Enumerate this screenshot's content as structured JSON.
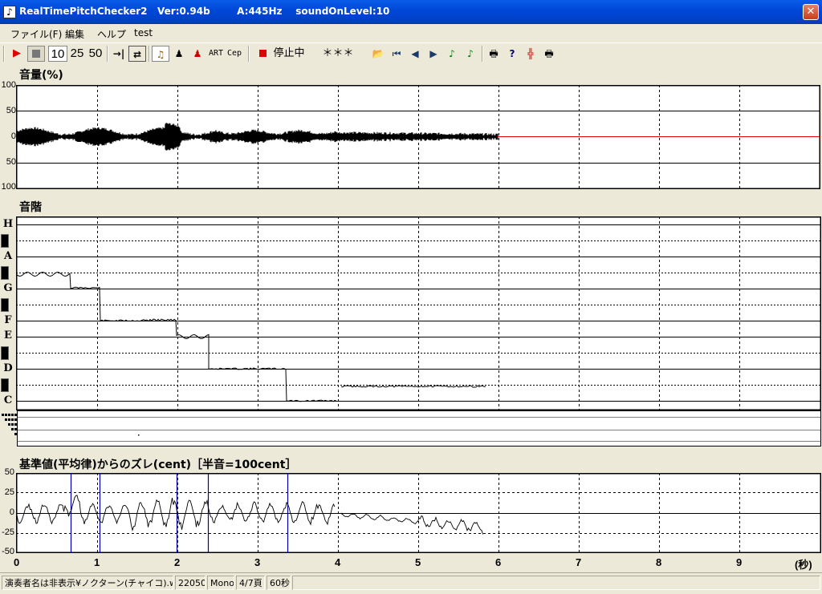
{
  "window": {
    "title": "RealTimePitchChecker2   Ver:0.94b        A:445Hz    soundOnLevel:10",
    "close_icon": "close-icon"
  },
  "menu": [
    "ファイル(F)",
    "編集",
    "ヘルプ",
    "test"
  ],
  "toolbar": {
    "speed_10": "10",
    "speed_25": "25",
    "speed_50": "50",
    "art_label": "ART",
    "cep_label": "Cep",
    "status_label": "停止中",
    "note_display": "＊＊＊",
    "colors": {
      "record": "#e00000",
      "green_note": "#008000"
    }
  },
  "volume_panel": {
    "label": "音量(%)",
    "y_ticks": [
      "100",
      "50",
      "0",
      "50",
      "100"
    ],
    "colors": {
      "waveform": "#000000",
      "silence_line": "#e00000"
    }
  },
  "scale_panel": {
    "label": "音階",
    "notes": [
      "H",
      "A",
      "G",
      "F",
      "E",
      "D",
      "C"
    ]
  },
  "cent_panel": {
    "label": "基準値(平均律)からのズレ(cent)［半音=100cent］",
    "y_ticks": [
      "50",
      "25",
      "0",
      "-25",
      "-50"
    ],
    "marker_color": "#0000a0"
  },
  "x_axis": {
    "ticks": [
      "0",
      "1",
      "2",
      "3",
      "4",
      "5",
      "6",
      "7",
      "8",
      "9"
    ],
    "unit": "(秒)"
  },
  "statusbar": {
    "file": "演奏者名は非表示¥ノクターン(チャイコ).wav",
    "rate": "22050",
    "channels": "Mono",
    "page": "4/7頁",
    "length": "60秒"
  }
}
